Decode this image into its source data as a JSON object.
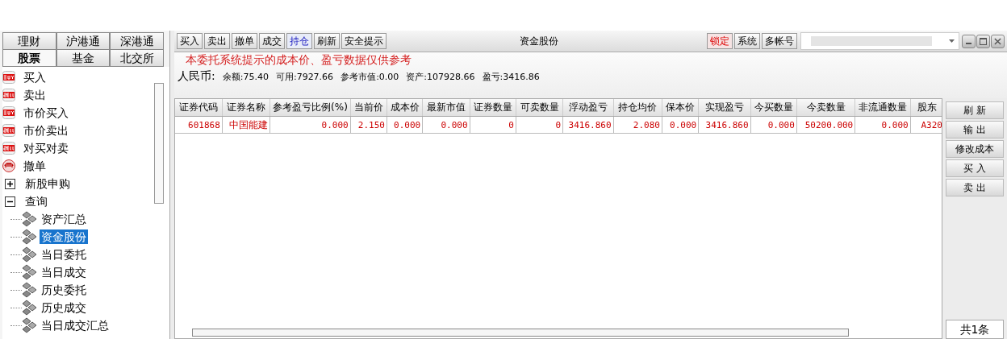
{
  "sidebar": {
    "tab_rows": [
      [
        {
          "label": "理财",
          "selected": false
        },
        {
          "label": "沪港通",
          "selected": false
        },
        {
          "label": "深港通",
          "selected": false
        }
      ],
      [
        {
          "label": "股票",
          "selected": true
        },
        {
          "label": "基金",
          "selected": false
        },
        {
          "label": "北交所",
          "selected": false
        }
      ]
    ],
    "tree": [
      {
        "kind": "buy",
        "label": "买入"
      },
      {
        "kind": "sell",
        "label": "卖出"
      },
      {
        "kind": "buy",
        "label": "市价买入"
      },
      {
        "kind": "sell",
        "label": "市价卖出"
      },
      {
        "kind": "sell",
        "label": "对买对卖"
      },
      {
        "kind": "cancel",
        "label": "撤单"
      },
      {
        "kind": "folder",
        "label": "新股申购",
        "expanded": false
      },
      {
        "kind": "folder",
        "label": "查询",
        "expanded": true,
        "children": [
          {
            "label": "资产汇总",
            "selected": false
          },
          {
            "label": "资金股份",
            "selected": true
          },
          {
            "label": "当日委托",
            "selected": false
          },
          {
            "label": "当日成交",
            "selected": false
          },
          {
            "label": "历史委托",
            "selected": false
          },
          {
            "label": "历史成交",
            "selected": false
          },
          {
            "label": "当日成交汇总",
            "selected": false
          }
        ]
      }
    ]
  },
  "toolbar": {
    "left_buttons": [
      {
        "label": "买入",
        "selected": false
      },
      {
        "label": "卖出",
        "selected": false
      },
      {
        "label": "撤单",
        "selected": false
      },
      {
        "label": "成交",
        "selected": false
      },
      {
        "label": "持仓",
        "selected": true
      },
      {
        "label": "刷新",
        "selected": false
      },
      {
        "label": "安全提示",
        "selected": false
      }
    ],
    "title": "资金股份",
    "right_buttons": [
      {
        "label": "锁定",
        "alert": true
      },
      {
        "label": "系统",
        "alert": false
      },
      {
        "label": "多帐号",
        "alert": false
      }
    ]
  },
  "notice": "本委托系统提示的成本价、盈亏数据仅供参考",
  "summary": {
    "currency": "人民币:",
    "items": [
      "余额:75.40",
      "可用:7927.66",
      "参考市值:0.00",
      "资产:107928.66",
      "盈亏:3416.86"
    ]
  },
  "table": {
    "columns": [
      "证券代码",
      "证券名称",
      "参考盈亏比例(%)",
      "当前价",
      "成本价",
      "最新市值",
      "证券数量",
      "可卖数量",
      "浮动盈亏",
      "持仓均价",
      "保本价",
      "实现盈亏",
      "今买数量",
      "今卖数量",
      "非流通数量",
      "股东"
    ],
    "rows": [
      [
        "601868",
        "中国能建",
        "0.000",
        "2.150",
        "0.000",
        "0.000",
        "0",
        "0",
        "3416.860",
        "2.080",
        "0.000",
        "3416.860",
        "0.000",
        "50200.000",
        "0.000",
        "A320"
      ]
    ]
  },
  "side_buttons": [
    "刷 新",
    "输 出",
    "修改成本",
    "买 入",
    "卖 出"
  ],
  "record_count": "共1条"
}
